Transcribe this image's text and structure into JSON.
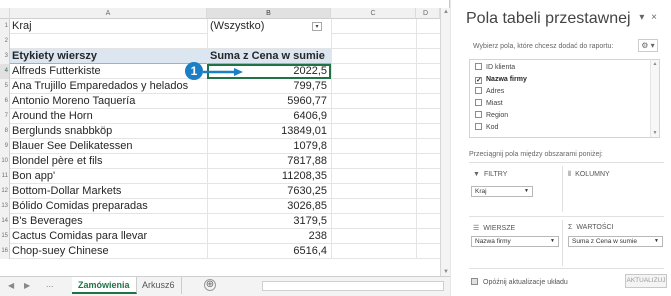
{
  "sheet": {
    "columns": [
      "A",
      "B",
      "C",
      "D"
    ],
    "filter": {
      "label": "Kraj",
      "value": "(Wszystko)",
      "dropdown_icon": "▾"
    },
    "header": {
      "col_a": "Etykiety wierszy",
      "col_b": "Suma z Cena w sumie"
    },
    "row_numbers": [
      "1",
      "2",
      "3",
      "4",
      "5",
      "6",
      "7",
      "8",
      "9",
      "10",
      "11",
      "12",
      "13",
      "14",
      "15",
      "16"
    ],
    "rows": [
      {
        "name": "Alfreds Futterkiste",
        "value": "2022,5"
      },
      {
        "name": "Ana Trujillo Emparedados y helados",
        "value": "799,75"
      },
      {
        "name": "Antonio Moreno Taquería",
        "value": "5960,77"
      },
      {
        "name": "Around the Horn",
        "value": "6406,9"
      },
      {
        "name": "Berglunds snabbköp",
        "value": "13849,01"
      },
      {
        "name": "Blauer See Delikatessen",
        "value": "1079,8"
      },
      {
        "name": "Blondel père et fils",
        "value": "7817,88"
      },
      {
        "name": "Bon app'",
        "value": "11208,35"
      },
      {
        "name": "Bottom-Dollar Markets",
        "value": "7630,25"
      },
      {
        "name": "Bólido Comidas preparadas",
        "value": "3026,85"
      },
      {
        "name": "B's Beverages",
        "value": "3179,5"
      },
      {
        "name": "Cactus Comidas para llevar",
        "value": "238"
      },
      {
        "name": "Chop-suey Chinese",
        "value": "6516,4"
      }
    ],
    "callout_number": "1",
    "tabs": {
      "active": "Zamówienia",
      "other": "Arkusz6",
      "ellipsis": "...",
      "add": "⊕"
    }
  },
  "pane": {
    "title": "Pola tabeli przestawnej",
    "controls": {
      "pin": "▾",
      "close": "×"
    },
    "subtitle": "Wybierz pola, które chcesz dodać do raportu:",
    "gear": "⚙ ▾",
    "fields": [
      {
        "label": "ID klienta",
        "checked": false
      },
      {
        "label": "Nazwa firmy",
        "checked": true
      },
      {
        "label": "Adres",
        "checked": false
      },
      {
        "label": "Miast",
        "checked": false
      },
      {
        "label": "Region",
        "checked": false
      },
      {
        "label": "Kod",
        "checked": false
      }
    ],
    "drag_label": "Przeciągnij pola między obszarami poniżej:",
    "areas": {
      "filters": {
        "header": "FILTRY",
        "icon": "filter-icon",
        "item": "Kraj"
      },
      "columns": {
        "header": "KOLUMNY",
        "icon": "columns-icon"
      },
      "rows": {
        "header": "WIERSZE",
        "icon": "rows-icon",
        "item": "Nazwa firmy"
      },
      "values": {
        "header": "WARTOŚCI",
        "icon": "sigma-icon",
        "item": "Suma z Cena w sumie"
      }
    },
    "defer_label": "Opóźnij aktualizacje układu",
    "update_button": "AKTUALIZUJ"
  },
  "colors": {
    "accent": "#217346",
    "callout": "#1a7fc4",
    "pivot_header": "#dce6f1"
  }
}
